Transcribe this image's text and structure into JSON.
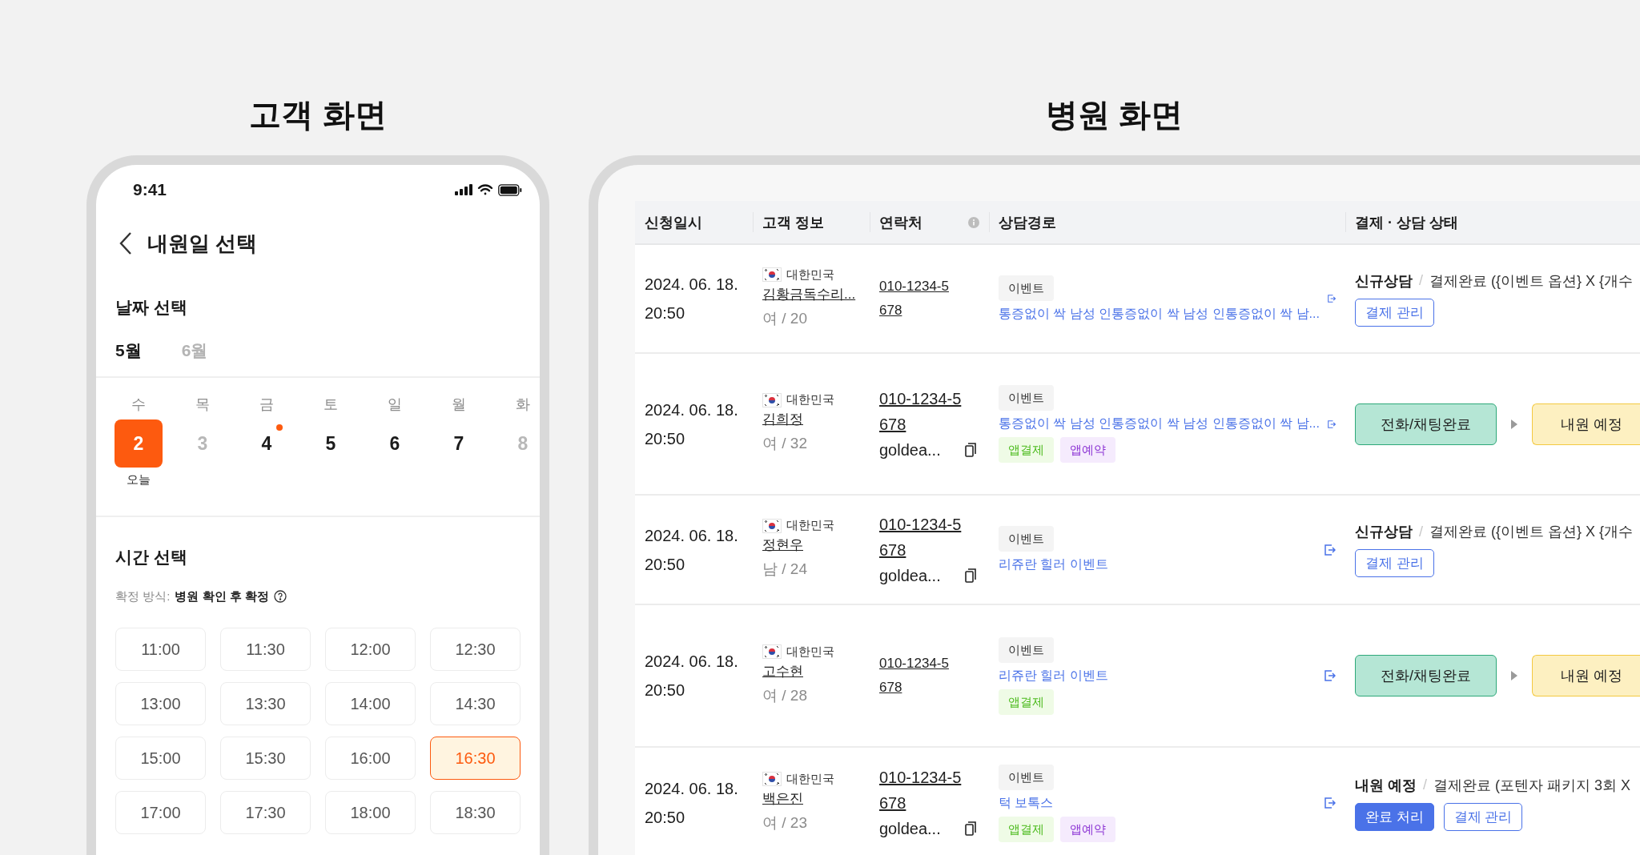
{
  "customer_screen": {
    "heading": "고객 화면",
    "status_bar": {
      "time": "9:41"
    },
    "title": "내원일 선택",
    "date_section": {
      "heading": "날짜 선택",
      "months": [
        {
          "label": "5월",
          "selected": true
        },
        {
          "label": "6월",
          "selected": false
        }
      ],
      "days": [
        {
          "weekday": "수",
          "date": "2",
          "selected": true,
          "disabled": false,
          "dot": false,
          "note": "오늘"
        },
        {
          "weekday": "목",
          "date": "3",
          "selected": false,
          "disabled": true,
          "dot": false
        },
        {
          "weekday": "금",
          "date": "4",
          "selected": false,
          "disabled": false,
          "dot": true
        },
        {
          "weekday": "토",
          "date": "5",
          "selected": false,
          "disabled": false,
          "dot": false
        },
        {
          "weekday": "일",
          "date": "6",
          "selected": false,
          "disabled": false,
          "dot": false
        },
        {
          "weekday": "월",
          "date": "7",
          "selected": false,
          "disabled": false,
          "dot": false
        },
        {
          "weekday": "화",
          "date": "8",
          "selected": false,
          "disabled": true,
          "dot": false
        }
      ]
    },
    "time_section": {
      "heading": "시간 선택",
      "method_label": "확정 방식:",
      "method_value": "병원 확인 후 확정",
      "slots": [
        {
          "label": "11:00",
          "selected": false
        },
        {
          "label": "11:30",
          "selected": false
        },
        {
          "label": "12:00",
          "selected": false
        },
        {
          "label": "12:30",
          "selected": false
        },
        {
          "label": "13:00",
          "selected": false
        },
        {
          "label": "13:30",
          "selected": false
        },
        {
          "label": "14:00",
          "selected": false
        },
        {
          "label": "14:30",
          "selected": false
        },
        {
          "label": "15:00",
          "selected": false
        },
        {
          "label": "15:30",
          "selected": false
        },
        {
          "label": "16:00",
          "selected": false
        },
        {
          "label": "16:30",
          "selected": true
        },
        {
          "label": "17:00",
          "selected": false
        },
        {
          "label": "17:30",
          "selected": false
        },
        {
          "label": "18:00",
          "selected": false
        },
        {
          "label": "18:30",
          "selected": false
        }
      ]
    }
  },
  "hospital_screen": {
    "heading": "병원 화면",
    "table": {
      "columns": [
        {
          "label": "신청일시"
        },
        {
          "label": "고객 정보"
        },
        {
          "label": "연락처",
          "info": true
        },
        {
          "label": "상담경로"
        },
        {
          "label": "결제 · 상담 상태"
        }
      ],
      "rows": [
        {
          "date": "2024. 06. 18.",
          "time": "20:50",
          "country": "대한민국",
          "name": "김황금독수리...",
          "gender_age": "여 / 20",
          "phone": "010-1234-5678",
          "route_tag": "이벤트",
          "route_text": "통증없이 싹 남성 인통증없이 싹 남성 인통증없이 싹 남...",
          "app_tags": [],
          "status": {
            "kind": "summary",
            "stage": "신규상담",
            "separator": "/",
            "detail": "결제완료 ({이벤트 옵션} X {개수",
            "buttons": [
              {
                "label": "결제 관리",
                "kind": "outline"
              }
            ]
          }
        },
        {
          "date": "2024. 06. 18.",
          "time": "20:50",
          "country": "대한민국",
          "name": "김희정",
          "gender_age": "여 / 32",
          "phone": "010-1234-5678",
          "email": "goldea...",
          "route_tag": "이벤트",
          "route_text": "통증없이 싹 남성 인통증없이 싹 남성 인통증없이 싹 남...",
          "app_tags": [
            {
              "label": "앱결제",
              "kind": "payment"
            },
            {
              "label": "앱예약",
              "kind": "reservation"
            }
          ],
          "status": {
            "kind": "flow",
            "steps": [
              {
                "label": "전화/채팅완료",
                "kind": "done"
              },
              {
                "label": "내원 예정",
                "kind": "next"
              }
            ]
          }
        },
        {
          "date": "2024. 06. 18.",
          "time": "20:50",
          "country": "대한민국",
          "name": "정현우",
          "gender_age": "남 / 24",
          "phone": "010-1234-5678",
          "email": "goldea...",
          "route_tag": "이벤트",
          "route_text": "리쥬란 힐러 이벤트",
          "app_tags": [],
          "status": {
            "kind": "summary",
            "stage": "신규상담",
            "separator": "/",
            "detail": "결제완료 ({이벤트 옵션} X {개수",
            "buttons": [
              {
                "label": "결제 관리",
                "kind": "outline"
              }
            ]
          }
        },
        {
          "date": "2024. 06. 18.",
          "time": "20:50",
          "country": "대한민국",
          "name": "고수현",
          "gender_age": "여 / 28",
          "phone": "010-1234-5678",
          "route_tag": "이벤트",
          "route_text": "리쥬란 힐러 이벤트",
          "app_tags": [
            {
              "label": "앱결제",
              "kind": "payment"
            }
          ],
          "status": {
            "kind": "flow",
            "steps": [
              {
                "label": "전화/채팅완료",
                "kind": "done"
              },
              {
                "label": "내원 예정",
                "kind": "next"
              }
            ]
          }
        },
        {
          "date": "2024. 06. 18.",
          "time": "20:50",
          "country": "대한민국",
          "name": "백은진",
          "gender_age": "여 / 23",
          "phone": "010-1234-5678",
          "email": "goldea...",
          "route_tag": "이벤트",
          "route_text": "턱 보톡스",
          "app_tags": [
            {
              "label": "앱결제",
              "kind": "payment"
            },
            {
              "label": "앱예약",
              "kind": "reservation"
            }
          ],
          "status": {
            "kind": "summary",
            "stage": "내원 예정",
            "separator": "/",
            "detail": "결제완료 (포텐자 패키지 3회 X",
            "buttons": [
              {
                "label": "완료 처리",
                "kind": "solid"
              },
              {
                "label": "결제 관리",
                "kind": "outline"
              }
            ]
          }
        }
      ]
    }
  }
}
